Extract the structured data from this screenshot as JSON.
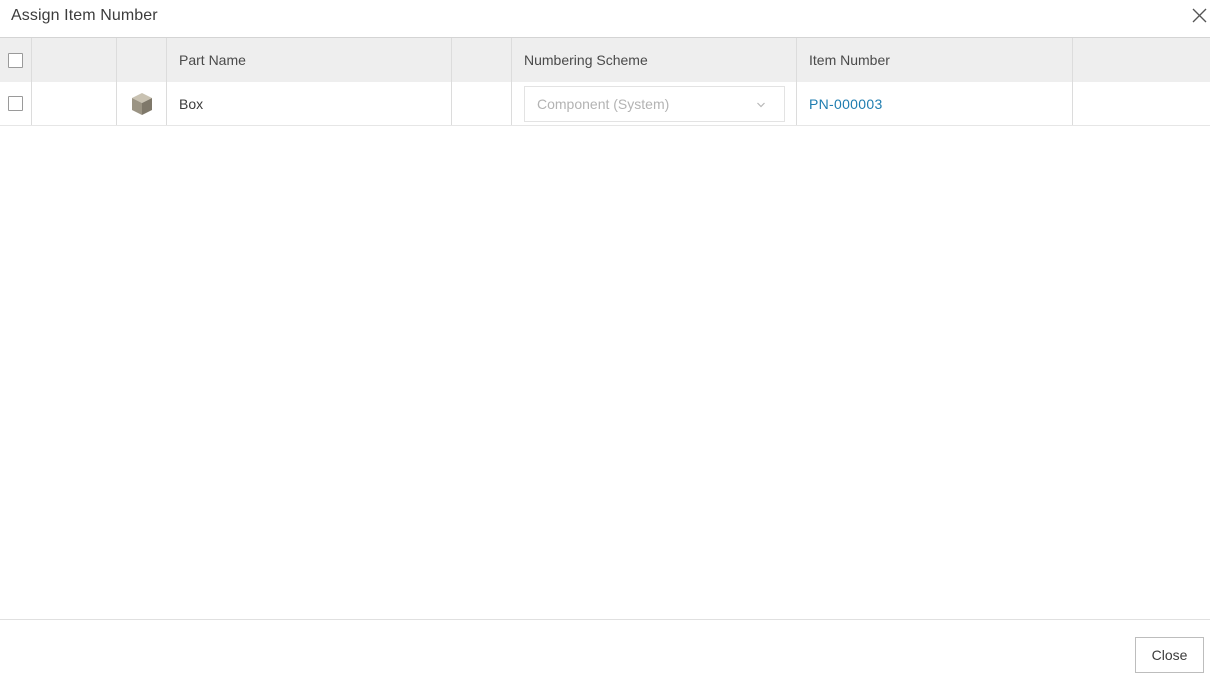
{
  "dialog": {
    "title": "Assign Item Number",
    "close_icon": "close-icon"
  },
  "table": {
    "columns": [
      "",
      "",
      "",
      "Part Name",
      "",
      "Numbering Scheme",
      "Item Number",
      ""
    ],
    "rows": [
      {
        "checked": false,
        "icon": "part-cube-icon",
        "part_name": "Box",
        "numbering_scheme": "Component (System)",
        "item_number": "PN-000003"
      }
    ]
  },
  "footer": {
    "close_label": "Close"
  },
  "colors": {
    "link": "#1f7db0",
    "header_bg": "#eeeeee",
    "disabled_text": "#b3b3b3"
  }
}
